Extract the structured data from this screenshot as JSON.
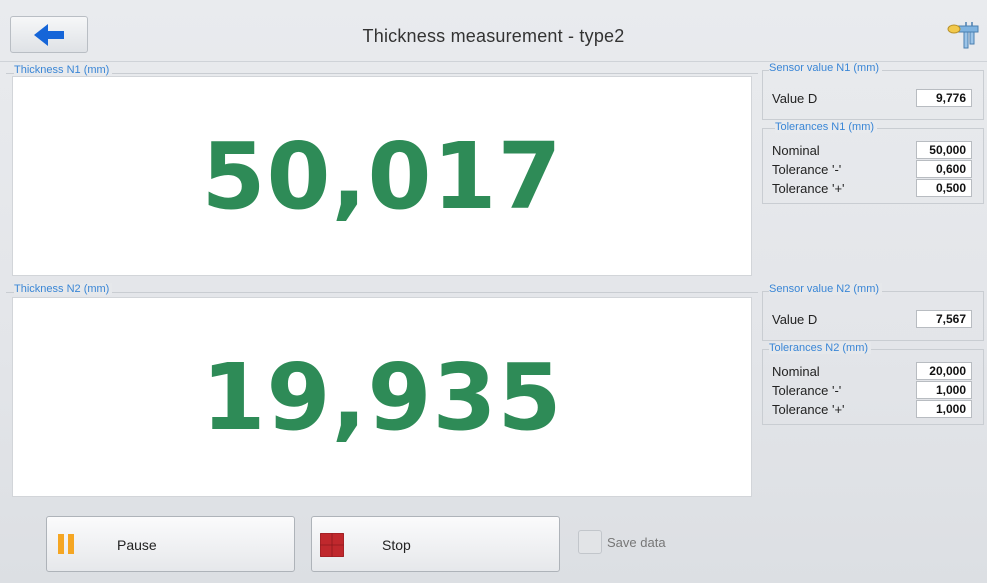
{
  "header": {
    "title": "Thickness measurement - type2",
    "back_icon": "arrow-left-icon",
    "tool_icon": "caliper-icon",
    "back_color": "#1565d8"
  },
  "n1": {
    "panel_label": "Thickness N1 (mm)",
    "value": "50,017",
    "sensor_label": "Sensor value N1 (mm)",
    "value_d_label": "Value D",
    "value_d": "9,776",
    "tolerances_label": "Tolerances N1 (mm)",
    "nominal_label": "Nominal",
    "nominal": "50,000",
    "tol_minus_label": "Tolerance '-'",
    "tol_minus": "0,600",
    "tol_plus_label": "Tolerance '+'",
    "tol_plus": "0,500"
  },
  "n2": {
    "panel_label": "Thickness N2 (mm)",
    "value": "19,935",
    "sensor_label": "Sensor value N2 (mm)",
    "value_d_label": "Value D",
    "value_d": "7,567",
    "tolerances_label": "Tolerances N2 (mm)",
    "nominal_label": "Nominal",
    "nominal": "20,000",
    "tol_minus_label": "Tolerance '-'",
    "tol_minus": "1,000",
    "tol_plus_label": "Tolerance '+'",
    "tol_plus": "1,000"
  },
  "controls": {
    "pause_label": "Pause",
    "pause_icon": "pause-icon",
    "pause_color": "#f5a623",
    "stop_label": "Stop",
    "stop_icon": "stop-icon",
    "stop_color": "#c0282d",
    "save_label": "Save data",
    "save_checked": false
  },
  "colors": {
    "value_text": "#2e8b57",
    "group_label": "#3a86d6"
  }
}
